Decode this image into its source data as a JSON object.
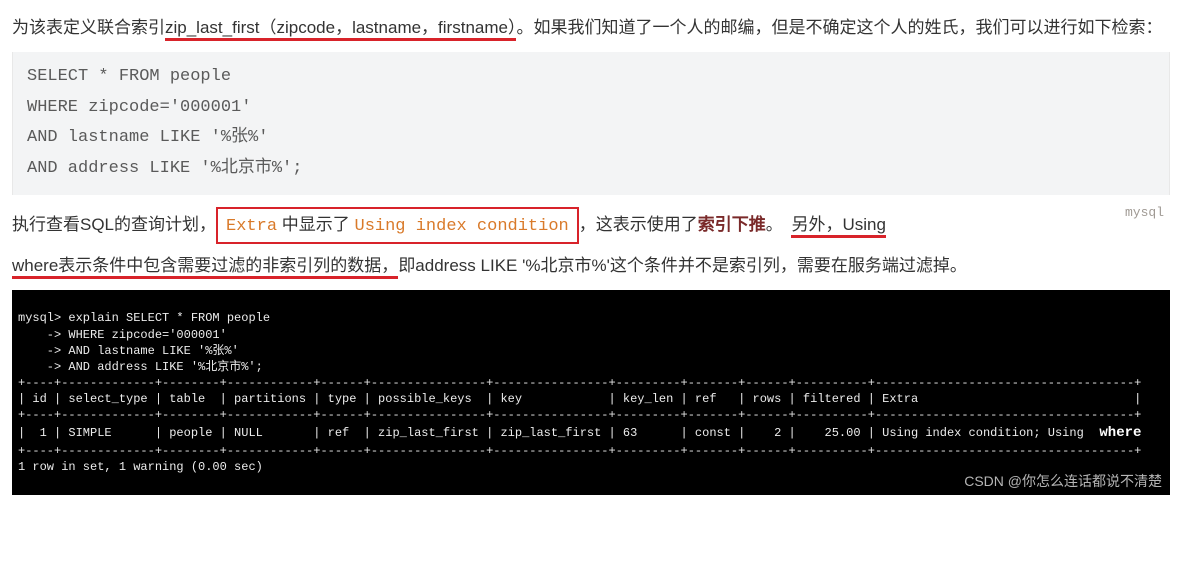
{
  "para1_pre": "为该表定义联合索引",
  "para1_idx": "zip_last_first（zipcode，lastname，firstname）",
  "para1_post": "。如果我们知道了一个人的邮编，但是不确定这个人的姓氏，我们可以进行如下检索：",
  "sql1": "SELECT * FROM people\nWHERE zipcode='000001'\nAND lastname LIKE '%张%'\nAND address LIKE '%北京市%';",
  "para2_a": "执行查看SQL的查询计划，",
  "para2_box_extra": "Extra",
  "para2_box_mid": " 中显示了 ",
  "para2_box_cond": "Using index condition",
  "para2_b": "，这表示使用了",
  "para2_bold": "索引下推",
  "para2_c": "。",
  "mysql_label": "mysql",
  "para2_trail": "另外，Using ",
  "para3_u": "where表示条件中包含需要过滤的非索引列的数据，",
  "para3_r": "即address LIKE '%北京市%'这个条件并不是索引列，需要在服务端过滤掉。",
  "term_cmd": "mysql> explain SELECT * FROM people\n    -> WHERE zipcode='000001'\n    -> AND lastname LIKE '%张%'\n    -> AND address LIKE '%北京市%';",
  "term_sep": "+----+-------------+--------+------------+------+----------------+----------------+---------+-------+------+----------+------------------------------------+",
  "term_hdr": "| id | select_type | table  | partitions | type | possible_keys  | key            | key_len | ref   | rows | filtered | Extra                              |",
  "term_row": "|  1 | SIMPLE      | people | NULL       | ref  | zip_last_first | zip_last_first | 63      | const |    2 |    25.00 | Using index condition; Using ",
  "term_row_where": " where ",
  "term_foot": "1 row in set, 1 warning (0.00 sec)",
  "watermark": "CSDN @你怎么连话都说不清楚"
}
